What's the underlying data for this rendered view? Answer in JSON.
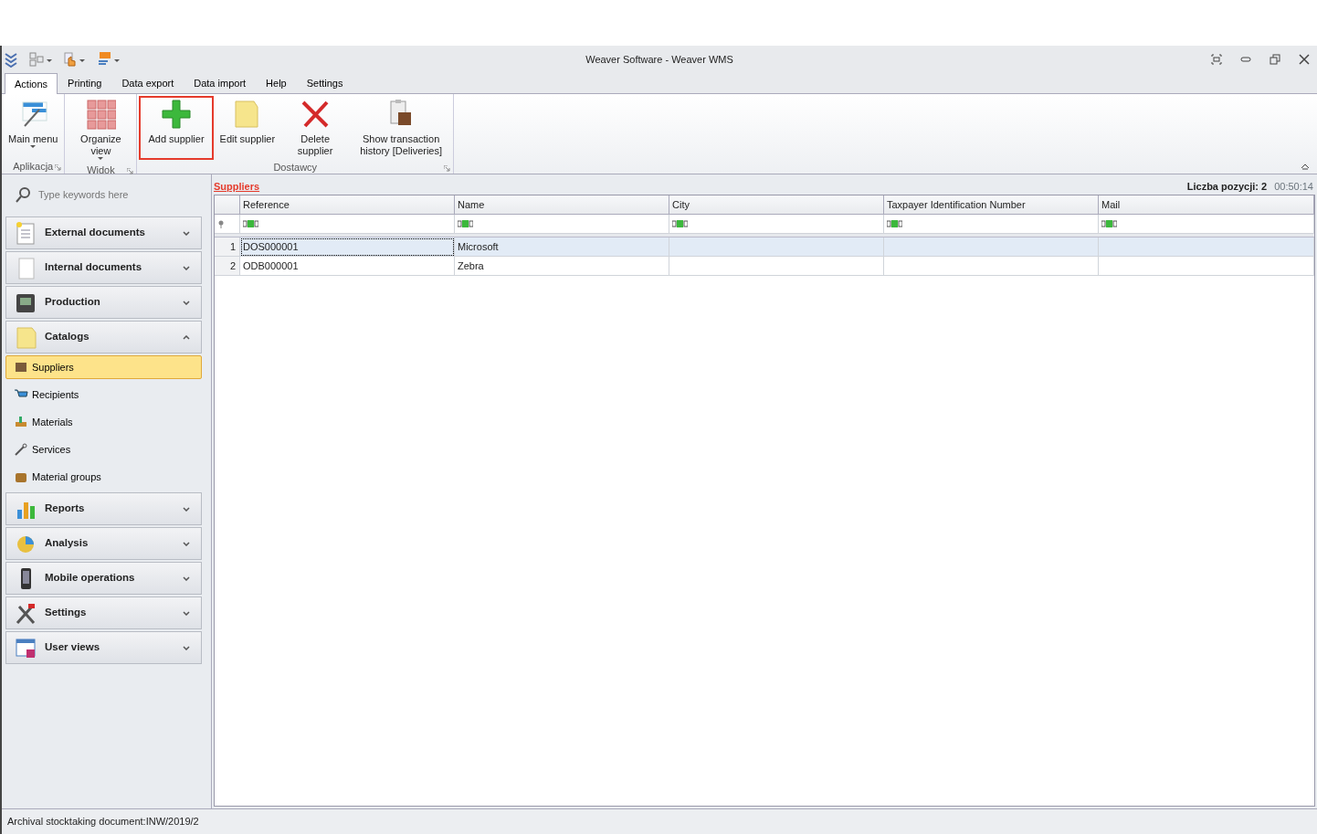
{
  "window": {
    "title": "Weaver Software - Weaver WMS"
  },
  "tabs": [
    {
      "label": "Actions",
      "selected": true
    },
    {
      "label": "Printing",
      "selected": false
    },
    {
      "label": "Data export",
      "selected": false
    },
    {
      "label": "Data import",
      "selected": false
    },
    {
      "label": "Help",
      "selected": false
    },
    {
      "label": "Settings",
      "selected": false
    }
  ],
  "ribbon_groups": [
    {
      "label": "Aplikacja",
      "buttons": [
        {
          "label": "Main menu",
          "kind": "menu",
          "dropdown": true,
          "highlighted": false
        }
      ]
    },
    {
      "label": "Widok",
      "buttons": [
        {
          "label": "Organize view",
          "kind": "grid",
          "dropdown": true,
          "highlighted": false
        }
      ]
    },
    {
      "label": "Dostawcy",
      "buttons": [
        {
          "label": "Add supplier",
          "kind": "add",
          "dropdown": false,
          "highlighted": true
        },
        {
          "label": "Edit supplier",
          "kind": "folder",
          "dropdown": false,
          "highlighted": false
        },
        {
          "label": "Delete supplier",
          "kind": "delete",
          "dropdown": false,
          "highlighted": false
        },
        {
          "label": "Show transaction history [Deliveries]",
          "kind": "history",
          "dropdown": false,
          "highlighted": false
        }
      ]
    }
  ],
  "sidebar": {
    "search": {
      "placeholder": "Type keywords here"
    },
    "groups": [
      {
        "label": "External documents",
        "expanded": false
      },
      {
        "label": "Internal documents",
        "expanded": false
      },
      {
        "label": "Production",
        "expanded": false
      },
      {
        "label": "Catalogs",
        "expanded": true,
        "items": [
          {
            "label": "Suppliers",
            "selected": true
          },
          {
            "label": "Recipients",
            "selected": false
          },
          {
            "label": "Materials",
            "selected": false
          },
          {
            "label": "Services",
            "selected": false
          },
          {
            "label": "Material groups",
            "selected": false
          }
        ]
      },
      {
        "label": "Reports",
        "expanded": false
      },
      {
        "label": "Analysis",
        "expanded": false
      },
      {
        "label": "Mobile operations",
        "expanded": false
      },
      {
        "label": "Settings",
        "expanded": false
      },
      {
        "label": "User views",
        "expanded": false
      }
    ]
  },
  "grid": {
    "title": "Suppliers",
    "count": "Liczba pozycji: 2",
    "time": "00:50:14",
    "columns": [
      "Reference",
      "Name",
      "City",
      "Taxpayer Identification Number",
      "Mail"
    ],
    "rows": [
      {
        "number": "1",
        "cells": [
          "DOS000001",
          "Microsoft",
          "",
          "",
          ""
        ],
        "selected": true
      },
      {
        "number": "2",
        "cells": [
          "ODB000001",
          "Zebra",
          "",
          "",
          ""
        ],
        "selected": false
      }
    ]
  },
  "status_bar": {
    "text": "Archival stocktaking document:INW/2019/2"
  }
}
